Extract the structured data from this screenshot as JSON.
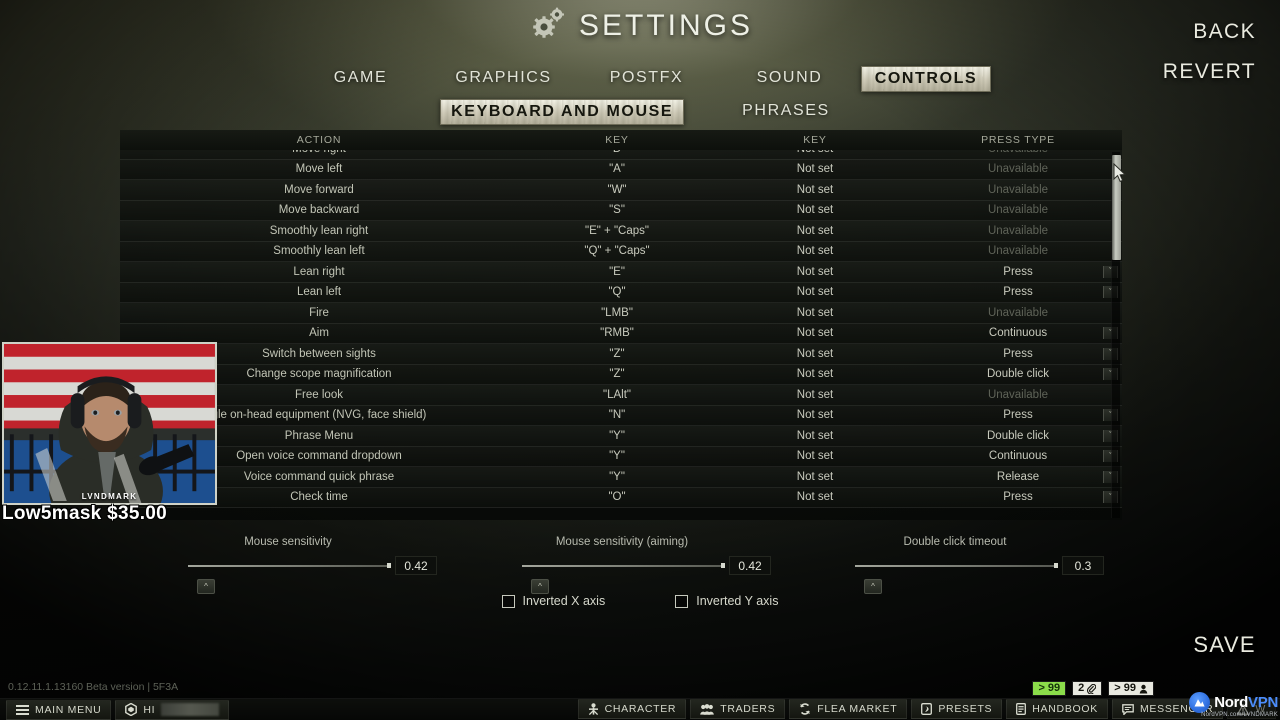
{
  "header": {
    "title": "SETTINGS",
    "gears_icon": "gears-icon",
    "back_label": "BACK",
    "revert_label": "REVERT",
    "save_label": "SAVE"
  },
  "tabs_main": [
    {
      "label": "GAME",
      "selected": false
    },
    {
      "label": "GRAPHICS",
      "selected": false
    },
    {
      "label": "POSTFX",
      "selected": false
    },
    {
      "label": "SOUND",
      "selected": false
    },
    {
      "label": "CONTROLS",
      "selected": true
    }
  ],
  "tabs_sub": [
    {
      "label": "KEYBOARD AND MOUSE",
      "selected": true
    },
    {
      "label": "PHRASES",
      "selected": false
    }
  ],
  "table": {
    "columns": [
      "ACTION",
      "KEY",
      "KEY",
      "PRESS TYPE"
    ],
    "rows": [
      {
        "action": "Move right",
        "key1": "\"D\"",
        "key2": "Not set",
        "press": "Unavailable",
        "disabled": true
      },
      {
        "action": "Move left",
        "key1": "\"A\"",
        "key2": "Not set",
        "press": "Unavailable",
        "disabled": true
      },
      {
        "action": "Move forward",
        "key1": "\"W\"",
        "key2": "Not set",
        "press": "Unavailable",
        "disabled": true
      },
      {
        "action": "Move backward",
        "key1": "\"S\"",
        "key2": "Not set",
        "press": "Unavailable",
        "disabled": true
      },
      {
        "action": "Smoothly lean right",
        "key1": "\"E\" + \"Caps\"",
        "key2": "Not set",
        "press": "Unavailable",
        "disabled": true
      },
      {
        "action": "Smoothly lean left",
        "key1": "\"Q\" + \"Caps\"",
        "key2": "Not set",
        "press": "Unavailable",
        "disabled": true
      },
      {
        "action": "Lean right",
        "key1": "\"E\"",
        "key2": "Not set",
        "press": "Press",
        "disabled": false
      },
      {
        "action": "Lean left",
        "key1": "\"Q\"",
        "key2": "Not set",
        "press": "Press",
        "disabled": false
      },
      {
        "action": "Fire",
        "key1": "\"LMB\"",
        "key2": "Not set",
        "press": "Unavailable",
        "disabled": true
      },
      {
        "action": "Aim",
        "key1": "\"RMB\"",
        "key2": "Not set",
        "press": "Continuous",
        "disabled": false
      },
      {
        "action": "Switch between sights",
        "key1": "\"Z\"",
        "key2": "Not set",
        "press": "Press",
        "disabled": false
      },
      {
        "action": "Change scope magnification",
        "key1": "\"Z\"",
        "key2": "Not set",
        "press": "Double click",
        "disabled": false
      },
      {
        "action": "Free look",
        "key1": "\"LAlt\"",
        "key2": "Not set",
        "press": "Unavailable",
        "disabled": true
      },
      {
        "action": "gle on-head equipment (NVG, face shield)",
        "key1": "\"N\"",
        "key2": "Not set",
        "press": "Press",
        "disabled": false
      },
      {
        "action": "Phrase Menu",
        "key1": "\"Y\"",
        "key2": "Not set",
        "press": "Double click",
        "disabled": false
      },
      {
        "action": "Open voice command dropdown",
        "key1": "\"Y\"",
        "key2": "Not set",
        "press": "Continuous",
        "disabled": false
      },
      {
        "action": "Voice command quick phrase",
        "key1": "\"Y\"",
        "key2": "Not set",
        "press": "Release",
        "disabled": false
      },
      {
        "action": "Check time",
        "key1": "\"O\"",
        "key2": "Not set",
        "press": "Press",
        "disabled": false
      }
    ],
    "dropdown_icon": "chevron-down-icon"
  },
  "sliders": [
    {
      "label": "Mouse sensitivity",
      "value": "0.42",
      "fill_percent": 88,
      "handle_icon": "chevron-up-icon"
    },
    {
      "label": "Mouse sensitivity (aiming)",
      "value": "0.42",
      "fill_percent": 88,
      "handle_icon": "chevron-up-icon"
    },
    {
      "label": "Double click timeout",
      "value": "0.3",
      "fill_percent": 88,
      "handle_icon": "chevron-up-icon"
    }
  ],
  "checkboxes": [
    {
      "label": "Inverted X axis",
      "checked": false
    },
    {
      "label": "Inverted Y axis",
      "checked": false
    }
  ],
  "overlay": {
    "streamer_name": "LVNDMARK",
    "donation_text": "Low5mask $35.00"
  },
  "footer": {
    "version": "0.12.11.1.13160 Beta version | 5F3A"
  },
  "taskbar": {
    "main_menu": {
      "label": "MAIN MENU",
      "icon": "hamburger-icon"
    },
    "player": {
      "label": "HI",
      "icon": "hexagon-icon"
    },
    "items": [
      {
        "label": "CHARACTER",
        "icon": "character-icon"
      },
      {
        "label": "TRADERS",
        "icon": "traders-icon"
      },
      {
        "label": "FLEA MARKET",
        "icon": "flea-market-icon"
      },
      {
        "label": "PRESETS",
        "icon": "presets-icon"
      },
      {
        "label": "HANDBOOK",
        "icon": "handbook-icon"
      },
      {
        "label": "MESSENGER",
        "icon": "messenger-icon"
      }
    ],
    "badges": [
      {
        "text": "> 99",
        "style": "green",
        "icon": ""
      },
      {
        "text": "2",
        "style": "white",
        "icon": "paperclip-icon"
      },
      {
        "text": "> 99",
        "style": "white",
        "icon": "person-icon"
      }
    ]
  },
  "watermark": {
    "brand_a": "Nord",
    "brand_b": "VPN",
    "sub": "NordVPN.com/LVNDMARK",
    "logo_icon": "nordvpn-logo-icon"
  },
  "colors": {
    "accent_green": "#8bdc4a",
    "badge_white": "#e8e8e0",
    "text_primary": "#e2e4d8",
    "text_dim": "#5f6358",
    "nord_blue": "#4c8dfb"
  }
}
